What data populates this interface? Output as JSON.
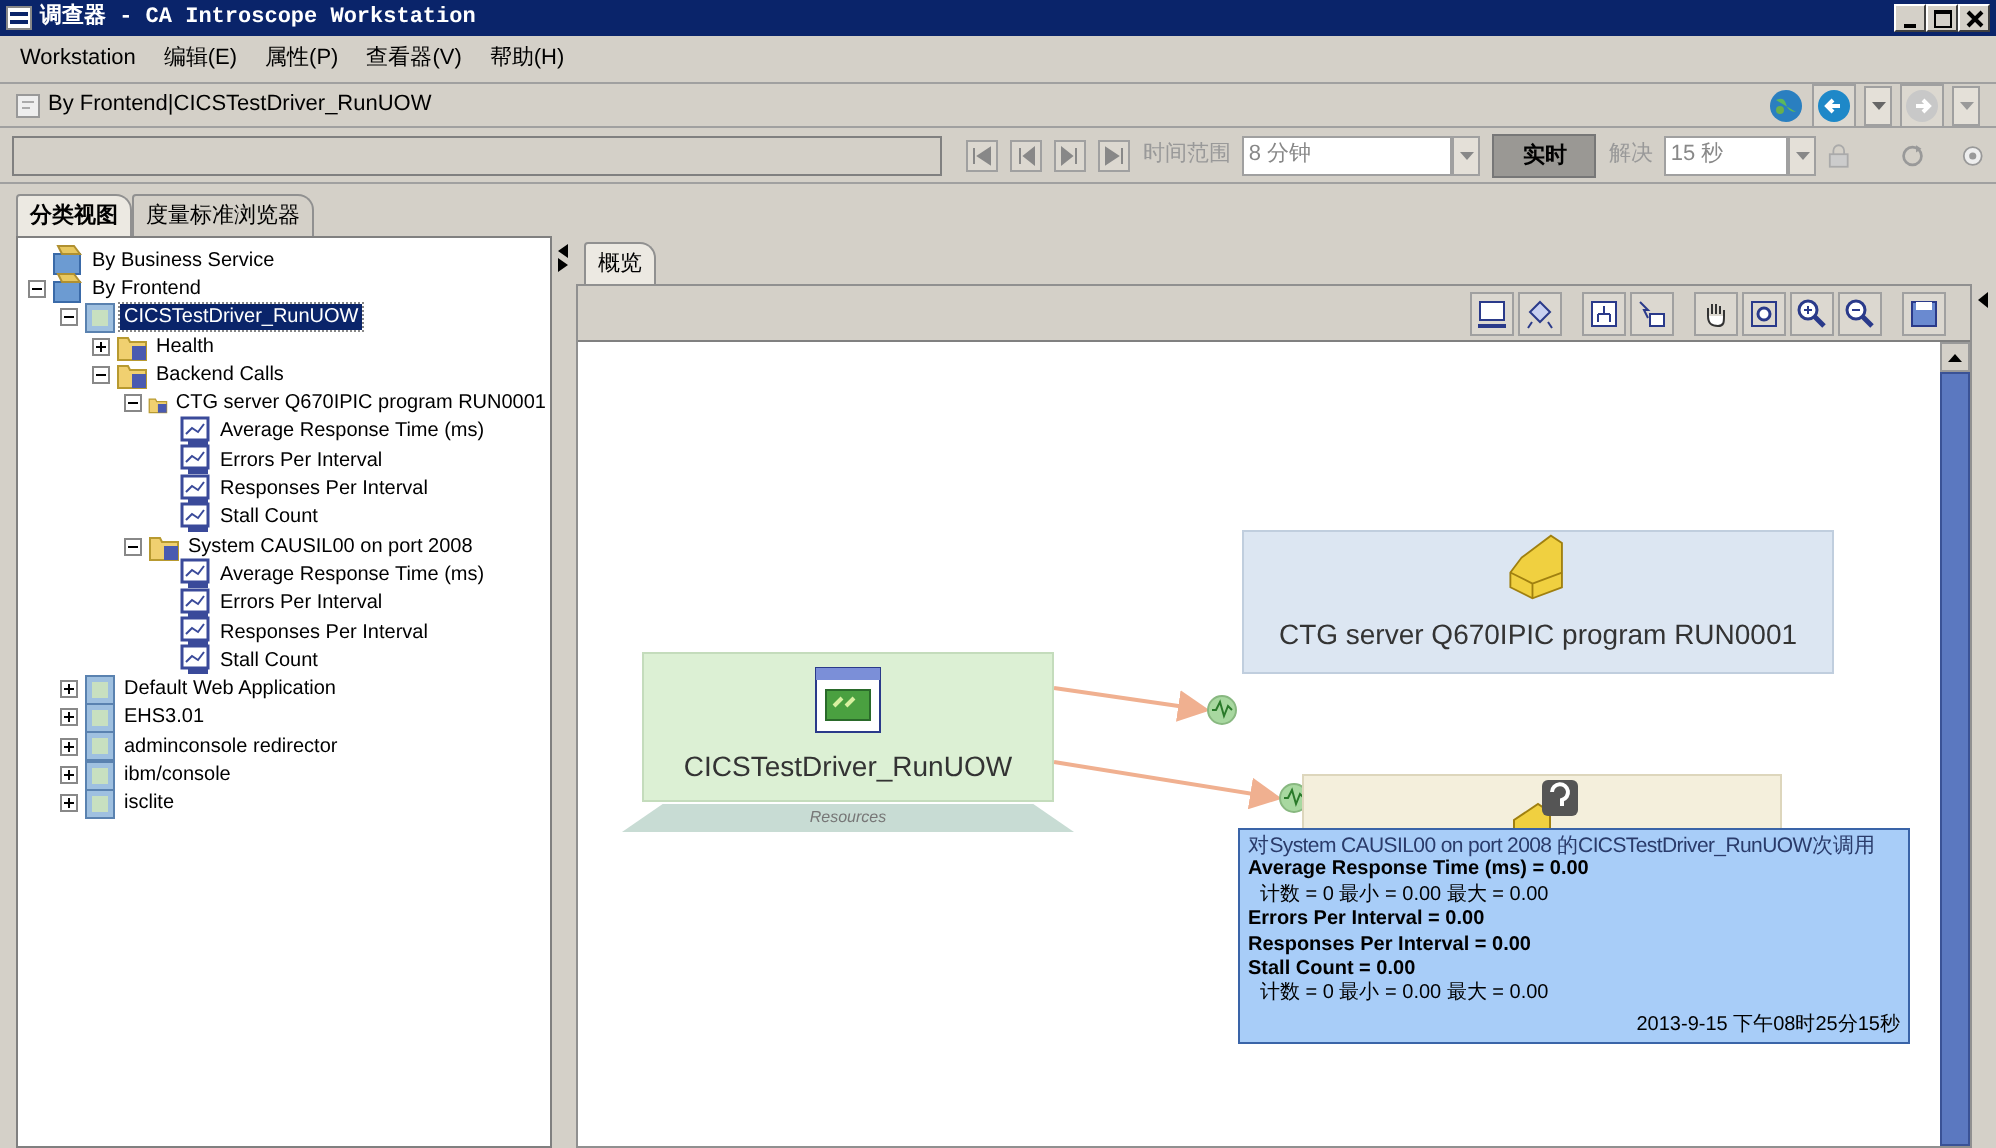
{
  "window": {
    "title": "调查器 - CA Introscope Workstation"
  },
  "menu": [
    {
      "label": "Workstation"
    },
    {
      "label": "编辑(E)"
    },
    {
      "label": "属性(P)"
    },
    {
      "label": "查看器(V)"
    },
    {
      "label": "帮助(H)"
    }
  ],
  "breadcrumb": "By Frontend|CICSTestDriver_RunUOW",
  "time_toolbar": {
    "time_range_label": "时间范围",
    "time_range": "8 分钟",
    "live_button": "实时",
    "resolution_label": "解决",
    "resolution": "15 秒"
  },
  "left_tabs": [
    {
      "label": "分类视图",
      "selected": true
    },
    {
      "label": "度量标准浏览器",
      "selected": false
    }
  ],
  "tree": [
    {
      "label": "By Business Service",
      "kind": "group",
      "selected": false
    },
    {
      "label": "By Frontend",
      "kind": "group",
      "expanded": true,
      "selected": false,
      "children": [
        {
          "label": "CICSTestDriver_RunUOW",
          "kind": "application",
          "expanded": true,
          "selected": true,
          "children": [
            {
              "label": "Health",
              "kind": "folder",
              "expanded": false,
              "selected": false
            },
            {
              "label": "Backend Calls",
              "kind": "folder",
              "expanded": true,
              "selected": false,
              "children": [
                {
                  "label": "CTG server Q670IPIC program RUN0001",
                  "kind": "folder",
                  "expanded": true,
                  "selected": false,
                  "children": [
                    {
                      "label": "Average Response Time (ms)",
                      "kind": "metric",
                      "selected": false
                    },
                    {
                      "label": "Errors Per Interval",
                      "kind": "metric",
                      "selected": false
                    },
                    {
                      "label": "Responses Per Interval",
                      "kind": "metric",
                      "selected": false
                    },
                    {
                      "label": "Stall Count",
                      "kind": "metric",
                      "selected": false
                    }
                  ]
                },
                {
                  "label": "System CAUSIL00 on port 2008",
                  "kind": "folder",
                  "expanded": true,
                  "selected": false,
                  "children": [
                    {
                      "label": "Average Response Time (ms)",
                      "kind": "metric",
                      "selected": false
                    },
                    {
                      "label": "Errors Per Interval",
                      "kind": "metric",
                      "selected": false
                    },
                    {
                      "label": "Responses Per Interval",
                      "kind": "metric",
                      "selected": false
                    },
                    {
                      "label": "Stall Count",
                      "kind": "metric",
                      "selected": false
                    }
                  ]
                }
              ]
            }
          ]
        },
        {
          "label": "Default Web Application",
          "kind": "application",
          "expanded": false,
          "selected": false
        },
        {
          "label": "EHS3.01",
          "kind": "application",
          "expanded": false,
          "selected": false
        },
        {
          "label": "adminconsole redirector",
          "kind": "application",
          "expanded": false,
          "selected": false
        },
        {
          "label": "ibm/console",
          "kind": "application",
          "expanded": false,
          "selected": false
        },
        {
          "label": "isclite",
          "kind": "application",
          "expanded": false,
          "selected": false
        }
      ]
    }
  ],
  "right_tabs": [
    {
      "label": "概览",
      "selected": true
    }
  ],
  "diagram": {
    "nodes": [
      {
        "kind": "frontend",
        "label": "CICSTestDriver_RunUOW",
        "footer": "Resources"
      },
      {
        "kind": "backend",
        "label": "CTG server Q670IPIC program RUN0001"
      },
      {
        "kind": "backend_unknown"
      }
    ],
    "tooltip": {
      "title": "对System CAUSIL00  on port 2008 的CICSTestDriver_RunUOW次调用",
      "lines": [
        {
          "kind": "metric",
          "text": "Average Response Time (ms) = 0.00"
        },
        {
          "kind": "detail",
          "text": "计数 = 0  最小 = 0.00  最大 = 0.00"
        },
        {
          "kind": "metric",
          "text": "Errors Per Interval = 0.00"
        },
        {
          "kind": "metric",
          "text": "Responses Per Interval = 0.00"
        },
        {
          "kind": "metric",
          "text": "Stall Count = 0.00"
        },
        {
          "kind": "detail",
          "text": "计数 = 0  最小 = 0.00  最大 = 0.00"
        }
      ],
      "timestamp": "2013-9-15 下午08时25分15秒"
    }
  }
}
